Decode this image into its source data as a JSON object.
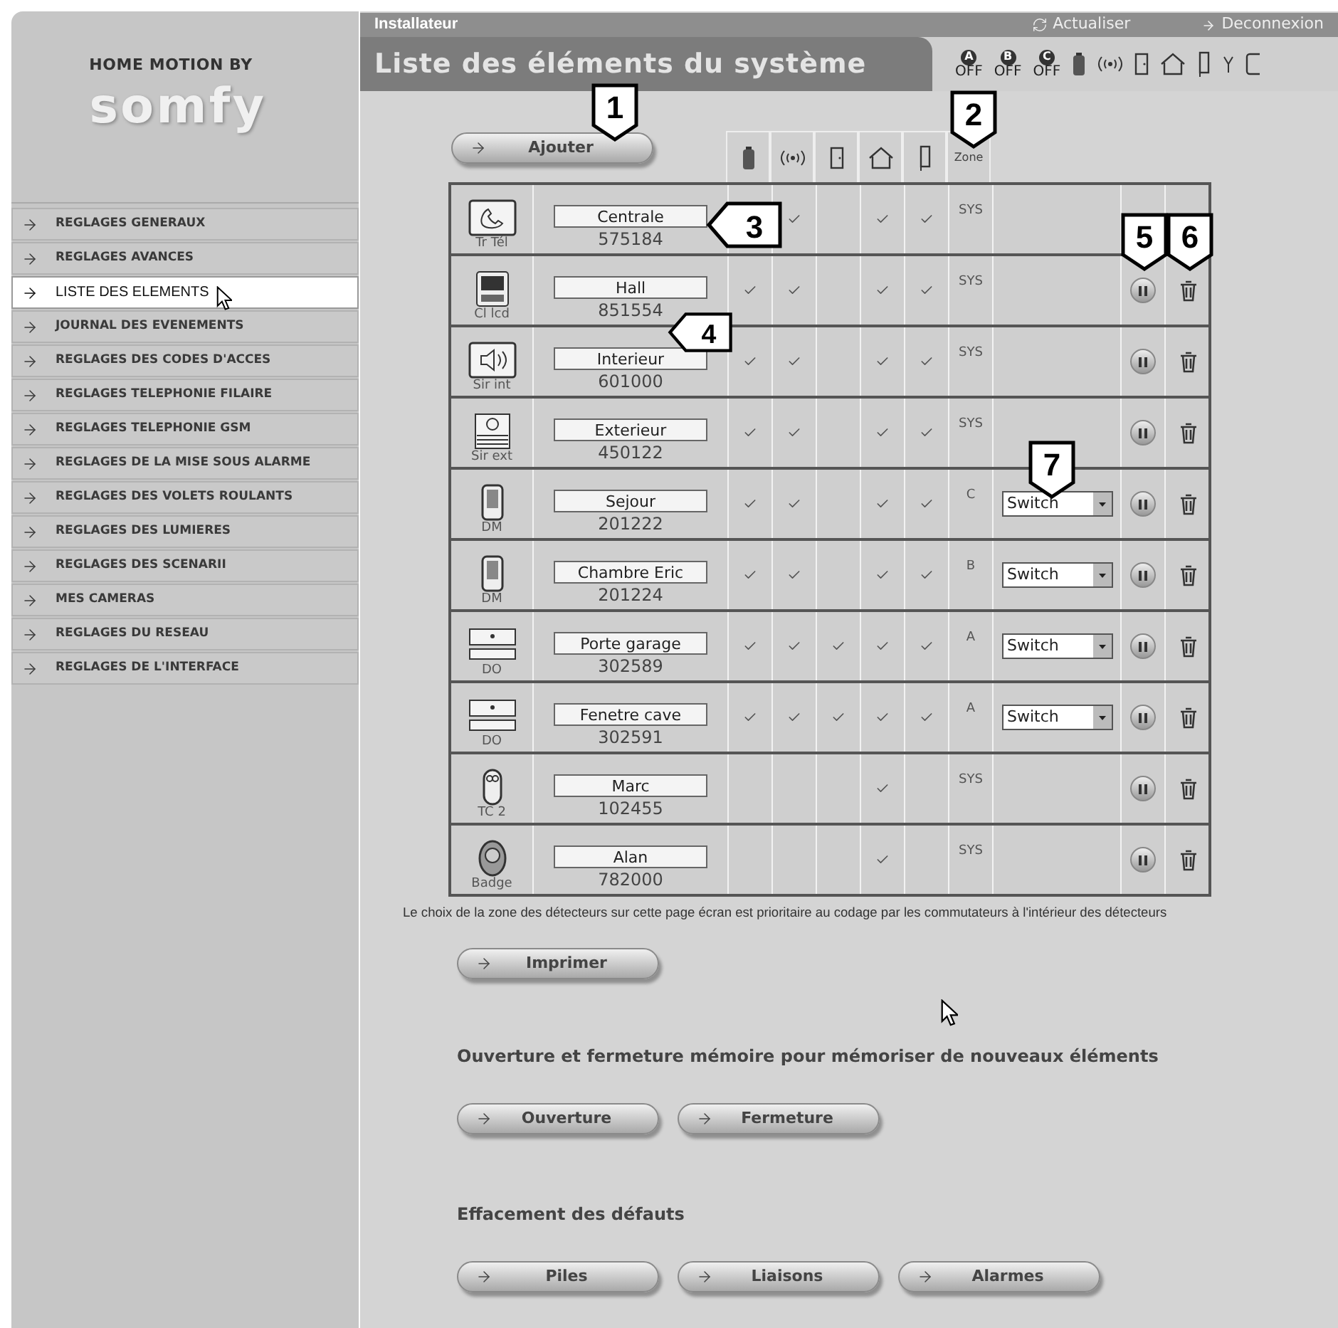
{
  "brand": {
    "tagline": "HOME MOTION BY",
    "logo": "somfy"
  },
  "sidebar": {
    "items": [
      {
        "label": "REGLAGES GENERAUX",
        "selected": false
      },
      {
        "label": "REGLAGES AVANCES",
        "selected": false
      },
      {
        "label": "LISTE DES ELEMENTS",
        "selected": true
      },
      {
        "label": "JOURNAL DES EVENEMENTS",
        "selected": false
      },
      {
        "label": "REGLAGES DES CODES D'ACCES",
        "selected": false
      },
      {
        "label": "REGLAGES TELEPHONIE FILAIRE",
        "selected": false
      },
      {
        "label": "REGLAGES TELEPHONIE GSM",
        "selected": false
      },
      {
        "label": "REGLAGES DE LA MISE SOUS ALARME",
        "selected": false
      },
      {
        "label": "REGLAGES DES VOLETS ROULANTS",
        "selected": false
      },
      {
        "label": "REGLAGES DES LUMIERES",
        "selected": false
      },
      {
        "label": "REGLAGES DES SCENARII",
        "selected": false
      },
      {
        "label": "MES CAMERAS",
        "selected": false
      },
      {
        "label": "REGLAGES DU RESEAU",
        "selected": false
      },
      {
        "label": "REGLAGES DE L'INTERFACE",
        "selected": false
      }
    ]
  },
  "top_bar": {
    "role": "Installateur",
    "refresh": "Actualiser",
    "logout": "Deconnexion"
  },
  "title_bar": {
    "title": "Liste des éléments du système",
    "zones": [
      {
        "letter": "A",
        "status": "OFF"
      },
      {
        "letter": "B",
        "status": "OFF"
      },
      {
        "letter": "C",
        "status": "OFF"
      }
    ]
  },
  "add_button": "Ajouter",
  "table": {
    "zone_heading": "Zone",
    "rows": [
      {
        "kind": "phone",
        "type": "Tr Tél",
        "name": "Centrale",
        "code": "575184",
        "checks": [
          false,
          true,
          false,
          true,
          true
        ],
        "zone": "SYS",
        "removable": false
      },
      {
        "kind": "lcd",
        "type": "Cl lcd",
        "name": "Hall",
        "code": "851554",
        "checks": [
          true,
          true,
          false,
          true,
          true
        ],
        "zone": "SYS",
        "removable": true
      },
      {
        "kind": "siren",
        "type": "Sir int",
        "name": "Interieur",
        "code": "601000",
        "checks": [
          true,
          true,
          false,
          true,
          true
        ],
        "zone": "SYS",
        "removable": true
      },
      {
        "kind": "outdoor-siren",
        "type": "Sir ext",
        "name": "Exterieur",
        "code": "450122",
        "checks": [
          true,
          true,
          false,
          true,
          true
        ],
        "zone": "SYS",
        "removable": true
      },
      {
        "kind": "motion",
        "type": "DM",
        "name": "Sejour",
        "code": "201222",
        "checks": [
          true,
          true,
          false,
          true,
          true
        ],
        "zone": "C",
        "mode": "Switch",
        "removable": true
      },
      {
        "kind": "motion",
        "type": "DM",
        "name": "Chambre Eric",
        "code": "201224",
        "checks": [
          true,
          true,
          false,
          true,
          true
        ],
        "zone": "B",
        "mode": "Switch",
        "removable": true
      },
      {
        "kind": "contact",
        "type": "DO",
        "name": "Porte garage",
        "code": "302589",
        "checks": [
          true,
          true,
          true,
          true,
          true
        ],
        "zone": "A",
        "mode": "Switch",
        "removable": true
      },
      {
        "kind": "contact",
        "type": "DO",
        "name": "Fenetre cave",
        "code": "302591",
        "checks": [
          true,
          true,
          true,
          true,
          true
        ],
        "zone": "A",
        "mode": "Switch",
        "removable": true
      },
      {
        "kind": "remote",
        "type": "TC 2",
        "name": "Marc",
        "code": "102455",
        "checks": [
          false,
          false,
          false,
          true,
          false
        ],
        "zone": "SYS",
        "removable": true
      },
      {
        "kind": "badge",
        "type": "Badge",
        "name": "Alan",
        "code": "782000",
        "checks": [
          false,
          false,
          false,
          true,
          false
        ],
        "zone": "SYS",
        "removable": true
      }
    ]
  },
  "note": "Le choix de la zone des détecteurs sur cette page écran est prioritaire au codage par les commutateurs à l'intérieur des détecteurs",
  "print_button": "Imprimer",
  "memory_section": {
    "heading": "Ouverture et fermeture mémoire pour mémoriser de nouveaux éléments",
    "buttons": [
      "Ouverture",
      "Fermeture"
    ]
  },
  "faults_section": {
    "heading": "Effacement des défauts",
    "buttons": [
      "Piles",
      "Liaisons",
      "Alarmes"
    ]
  },
  "callouts": [
    {
      "label": "1",
      "kind": "down"
    },
    {
      "label": "2",
      "kind": "down"
    },
    {
      "label": "3",
      "kind": "left"
    },
    {
      "label": "4",
      "kind": "left"
    },
    {
      "label": "5",
      "kind": "down"
    },
    {
      "label": "6",
      "kind": "down"
    },
    {
      "label": "7",
      "kind": "down"
    }
  ]
}
